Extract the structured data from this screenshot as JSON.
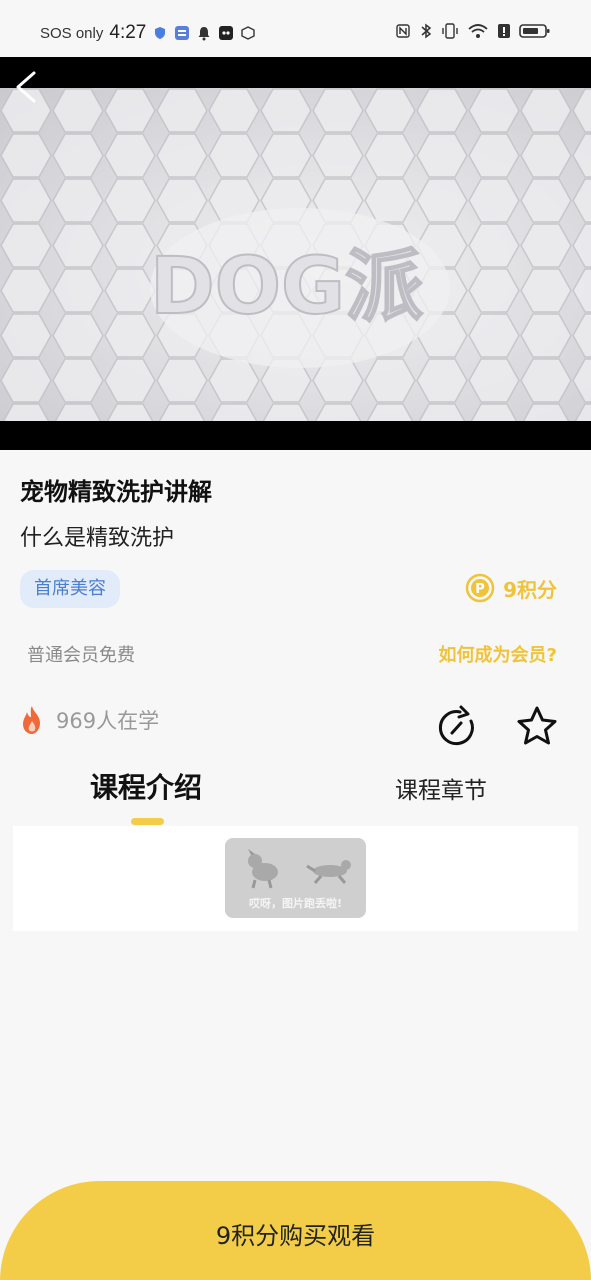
{
  "status_bar": {
    "carrier": "SOS only",
    "time": "4:27"
  },
  "video": {
    "logo_text": "DOG派"
  },
  "course": {
    "title": "宠物精致洗护讲解",
    "subtitle": "什么是精致洗护",
    "tag": "首席美容",
    "price": "9积分",
    "member_note": "普通会员免费",
    "how_member_link": "如何成为会员?",
    "learners": "969人在学"
  },
  "tabs": {
    "intro": "课程介绍",
    "chapters": "课程章节"
  },
  "content": {
    "image_error": "哎呀，图片跑丢啦!"
  },
  "buy_button": {
    "label": "9积分购买观看"
  },
  "colors": {
    "accent_yellow": "#f4cd48",
    "price_yellow": "#f0c43a",
    "tag_bg": "#e2ebf9",
    "tag_text": "#4a7fd0",
    "fire": "#f0693a"
  },
  "icons": [
    "back-icon",
    "share-icon",
    "star-icon",
    "fire-icon",
    "coin-icon"
  ]
}
